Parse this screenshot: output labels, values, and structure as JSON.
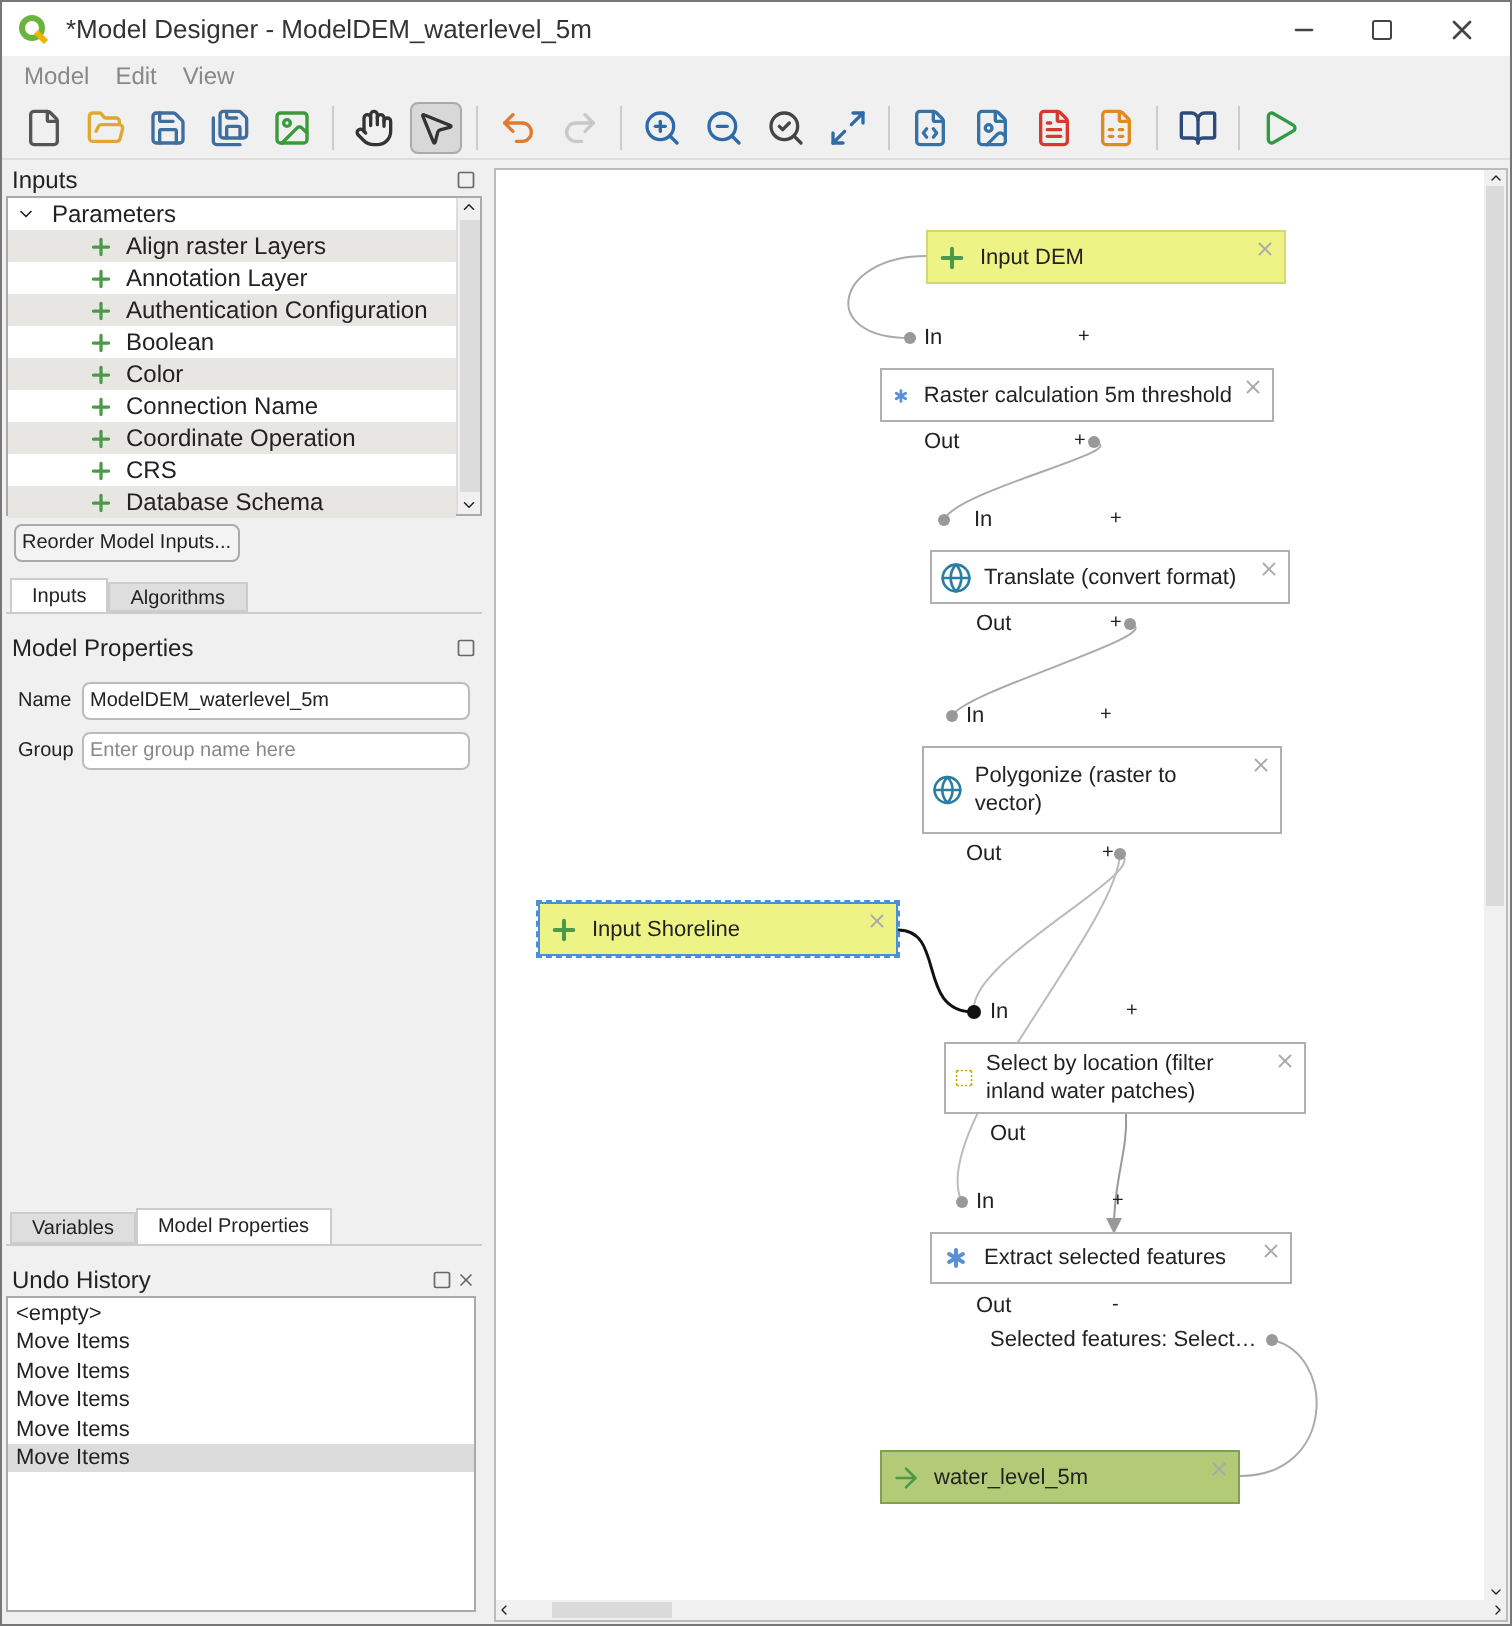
{
  "window": {
    "title": "*Model Designer - ModelDEM_waterlevel_5m"
  },
  "menu": [
    {
      "label": "Model"
    },
    {
      "label": "Edit"
    },
    {
      "label": "View"
    }
  ],
  "toolbar": [
    {
      "kind": "new",
      "selected": false
    },
    {
      "kind": "open",
      "selected": false
    },
    {
      "kind": "save",
      "selected": false
    },
    {
      "kind": "save-as",
      "selected": false
    },
    {
      "kind": "save-project",
      "selected": false
    },
    {
      "kind": "sep"
    },
    {
      "kind": "pan",
      "selected": false
    },
    {
      "kind": "select",
      "selected": true
    },
    {
      "kind": "sep"
    },
    {
      "kind": "undo",
      "selected": false
    },
    {
      "kind": "redo",
      "selected": false,
      "disabled": true
    },
    {
      "kind": "sep"
    },
    {
      "kind": "zoom-in",
      "selected": false
    },
    {
      "kind": "zoom-out",
      "selected": false
    },
    {
      "kind": "zoom-actual",
      "selected": false
    },
    {
      "kind": "zoom-full",
      "selected": false
    },
    {
      "kind": "sep"
    },
    {
      "kind": "export-python",
      "selected": false
    },
    {
      "kind": "export-image",
      "selected": false
    },
    {
      "kind": "export-pdf",
      "selected": false
    },
    {
      "kind": "export-svg",
      "selected": false
    },
    {
      "kind": "sep"
    },
    {
      "kind": "help",
      "selected": false
    },
    {
      "kind": "sep"
    },
    {
      "kind": "run",
      "selected": false
    }
  ],
  "inputs_panel": {
    "title": "Inputs",
    "tree": {
      "label": "Parameters",
      "expanded": true,
      "children": [
        {
          "label": "Align raster Layers"
        },
        {
          "label": "Annotation Layer"
        },
        {
          "label": "Authentication Configuration"
        },
        {
          "label": "Boolean"
        },
        {
          "label": "Color"
        },
        {
          "label": "Connection Name"
        },
        {
          "label": "Coordinate Operation"
        },
        {
          "label": "CRS"
        },
        {
          "label": "Database Schema"
        }
      ]
    },
    "button": "Reorder Model Inputs..."
  },
  "top_tabs": [
    {
      "label": "Inputs",
      "selected": true
    },
    {
      "label": "Algorithms",
      "selected": false
    }
  ],
  "model_properties": {
    "title": "Model Properties",
    "fields": [
      {
        "label": "Name",
        "value": "ModelDEM_waterlevel_5m"
      },
      {
        "label": "Group",
        "placeholder": "Enter group name here"
      }
    ]
  },
  "bottom_tabs": [
    {
      "label": "Variables",
      "selected": false
    },
    {
      "label": "Model Properties",
      "selected": true
    }
  ],
  "undo_history": {
    "title": "Undo History",
    "items": [
      {
        "label": "<empty>",
        "selected": false
      },
      {
        "label": "Move Items",
        "selected": false
      },
      {
        "label": "Move Items",
        "selected": false
      },
      {
        "label": "Move Items",
        "selected": false
      },
      {
        "label": "Move Items",
        "selected": false
      },
      {
        "label": "Move Items",
        "selected": true
      }
    ]
  },
  "diagram": {
    "nodes": [
      {
        "kind": "input",
        "label": "Input DEM",
        "selected": false
      },
      {
        "kind": "calc",
        "label": "Raster calculation 5m threshold",
        "selected": false
      },
      {
        "kind": "gdal",
        "label": "Translate (convert format)",
        "selected": false
      },
      {
        "kind": "gdal",
        "label": "Polygonize (raster to vector)",
        "selected": false
      },
      {
        "kind": "input",
        "label": "Input Shoreline",
        "selected": true
      },
      {
        "kind": "select",
        "label": "Select by location (filter inland water patches)",
        "selected": false
      },
      {
        "kind": "calc",
        "label": "Extract selected features",
        "selected": false
      },
      {
        "kind": "output",
        "label": "water_level_5m",
        "selected": false
      }
    ],
    "ports": [
      {
        "kind": "port",
        "label": "In"
      },
      {
        "kind": "toggle",
        "label": "+"
      },
      {
        "kind": "port",
        "label": "Out"
      },
      {
        "kind": "toggle",
        "label": "+"
      },
      {
        "kind": "port",
        "label": "In"
      },
      {
        "kind": "toggle",
        "label": "+"
      },
      {
        "kind": "port",
        "label": "Out"
      },
      {
        "kind": "toggle",
        "label": "+"
      },
      {
        "kind": "port",
        "label": "In"
      },
      {
        "kind": "toggle",
        "label": "+"
      },
      {
        "kind": "port",
        "label": "Out"
      },
      {
        "kind": "toggle",
        "label": "+"
      },
      {
        "kind": "port",
        "label": "In"
      },
      {
        "kind": "toggle",
        "label": "+"
      },
      {
        "kind": "port",
        "label": "Out"
      },
      {
        "kind": "port",
        "label": "In"
      },
      {
        "kind": "toggle",
        "label": "+"
      },
      {
        "kind": "port",
        "label": "Out"
      },
      {
        "kind": "toggle",
        "label": "-"
      },
      {
        "kind": "port",
        "label": "Selected features: Select…"
      }
    ]
  }
}
